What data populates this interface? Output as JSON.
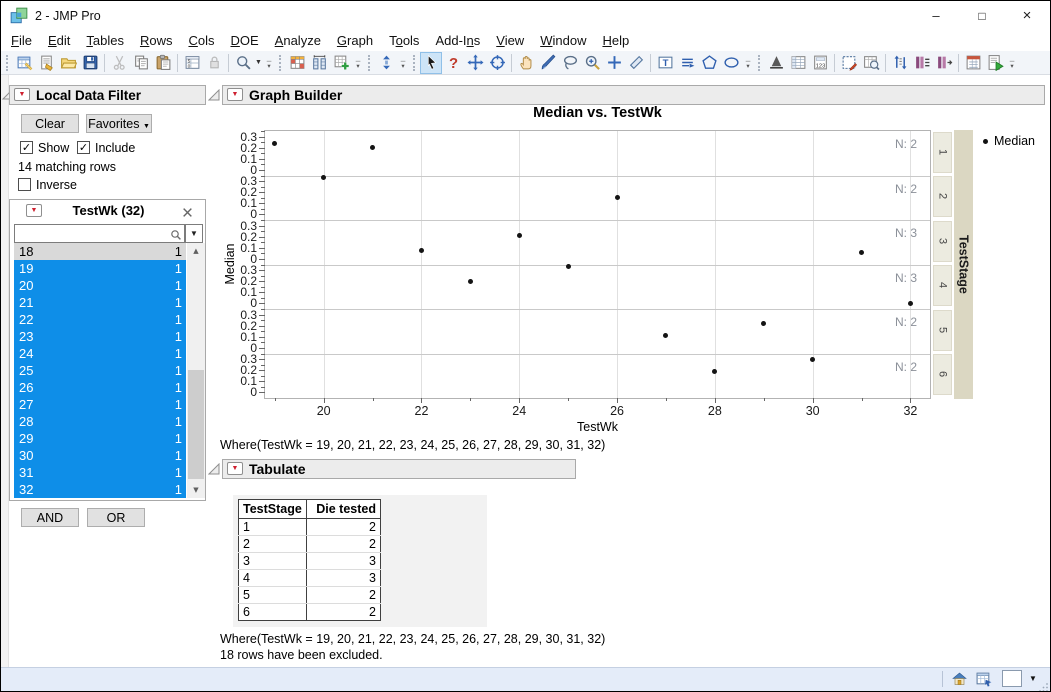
{
  "window": {
    "title": "2 - JMP Pro",
    "controls": {
      "minimize": "–",
      "maximize": "□",
      "close": "×"
    }
  },
  "menu": {
    "items": [
      {
        "label": "File",
        "accel": 0
      },
      {
        "label": "Edit",
        "accel": 0
      },
      {
        "label": "Tables",
        "accel": 0
      },
      {
        "label": "Rows",
        "accel": 0
      },
      {
        "label": "Cols",
        "accel": 0
      },
      {
        "label": "DOE",
        "accel": 0
      },
      {
        "label": "Analyze",
        "accel": 0
      },
      {
        "label": "Graph",
        "accel": 0
      },
      {
        "label": "Tools",
        "accel": 1
      },
      {
        "label": "Add-Ins",
        "accel": 5
      },
      {
        "label": "View",
        "accel": 0
      },
      {
        "label": "Window",
        "accel": 0
      },
      {
        "label": "Help",
        "accel": 0
      }
    ]
  },
  "toolbar": {
    "items": [
      {
        "t": "grip"
      },
      {
        "t": "icon",
        "name": "new-data-table"
      },
      {
        "t": "icon",
        "name": "journal"
      },
      {
        "t": "icon",
        "name": "open"
      },
      {
        "t": "icon",
        "name": "save"
      },
      {
        "t": "sep"
      },
      {
        "t": "icon",
        "name": "cut",
        "disabled": true
      },
      {
        "t": "icon",
        "name": "copy"
      },
      {
        "t": "icon",
        "name": "paste"
      },
      {
        "t": "sep"
      },
      {
        "t": "icon",
        "name": "data-table-window"
      },
      {
        "t": "icon",
        "name": "lock",
        "disabled": true
      },
      {
        "t": "sep"
      },
      {
        "t": "icon",
        "name": "search"
      },
      {
        "t": "dd"
      },
      {
        "t": "ovf"
      },
      {
        "t": "grip"
      },
      {
        "t": "icon",
        "name": "colored-table"
      },
      {
        "t": "icon",
        "name": "compare-columns"
      },
      {
        "t": "icon",
        "name": "add-table"
      },
      {
        "t": "ovf"
      },
      {
        "t": "grip"
      },
      {
        "t": "icon",
        "name": "navigate"
      },
      {
        "t": "ovf"
      },
      {
        "t": "grip"
      },
      {
        "t": "icon",
        "name": "arrow-tool",
        "selected": true
      },
      {
        "t": "icon",
        "name": "help-tool"
      },
      {
        "t": "icon",
        "name": "move-tool"
      },
      {
        "t": "icon",
        "name": "target-tool"
      },
      {
        "t": "sep"
      },
      {
        "t": "icon",
        "name": "hand-tool"
      },
      {
        "t": "icon",
        "name": "brush-tool"
      },
      {
        "t": "icon",
        "name": "lasso-tool"
      },
      {
        "t": "icon",
        "name": "zoom-tool"
      },
      {
        "t": "icon",
        "name": "crosshair-tool"
      },
      {
        "t": "icon",
        "name": "eraser-tool"
      },
      {
        "t": "sep"
      },
      {
        "t": "icon",
        "name": "text-annotate"
      },
      {
        "t": "icon",
        "name": "line-annotate"
      },
      {
        "t": "icon",
        "name": "polygon-annotate"
      },
      {
        "t": "icon",
        "name": "oval-annotate"
      },
      {
        "t": "ovf"
      },
      {
        "t": "grip"
      },
      {
        "t": "icon",
        "name": "distribution"
      },
      {
        "t": "icon",
        "name": "grid-list"
      },
      {
        "t": "icon",
        "name": "calculator"
      },
      {
        "t": "sep"
      },
      {
        "t": "icon",
        "name": "edit-select"
      },
      {
        "t": "icon",
        "name": "table-search"
      },
      {
        "t": "sep"
      },
      {
        "t": "icon",
        "name": "sort-columns"
      },
      {
        "t": "icon",
        "name": "join-columns"
      },
      {
        "t": "icon",
        "name": "split-columns"
      },
      {
        "t": "sep"
      },
      {
        "t": "icon",
        "name": "formula-table"
      },
      {
        "t": "icon",
        "name": "run-script"
      },
      {
        "t": "ovf"
      }
    ]
  },
  "filter_panel": {
    "title": "Local Data Filter",
    "clear_label": "Clear",
    "favorites_label": "Favorites",
    "show_label": "Show",
    "include_label": "Include",
    "matching_text": "14 matching rows",
    "inverse_label": "Inverse",
    "and_label": "AND",
    "or_label": "OR",
    "field": {
      "title": "TestWk (32)",
      "search_value": "",
      "items": [
        {
          "value": "18",
          "count": "1",
          "state": "excluded"
        },
        {
          "value": "19",
          "count": "1",
          "state": "selected"
        },
        {
          "value": "20",
          "count": "1",
          "state": "selected"
        },
        {
          "value": "21",
          "count": "1",
          "state": "selected"
        },
        {
          "value": "22",
          "count": "1",
          "state": "selected"
        },
        {
          "value": "23",
          "count": "1",
          "state": "selected"
        },
        {
          "value": "24",
          "count": "1",
          "state": "selected"
        },
        {
          "value": "25",
          "count": "1",
          "state": "selected"
        },
        {
          "value": "26",
          "count": "1",
          "state": "selected"
        },
        {
          "value": "27",
          "count": "1",
          "state": "selected"
        },
        {
          "value": "28",
          "count": "1",
          "state": "selected"
        },
        {
          "value": "29",
          "count": "1",
          "state": "selected"
        },
        {
          "value": "30",
          "count": "1",
          "state": "selected"
        },
        {
          "value": "31",
          "count": "1",
          "state": "selected"
        },
        {
          "value": "32",
          "count": "1",
          "state": "selected"
        }
      ]
    }
  },
  "graph_builder": {
    "title": "Graph Builder",
    "where_text": "Where(TestWk = 19, 20, 21, 22, 23, 24, 25, 26, 27, 28, 29, 30, 31, 32)"
  },
  "chart_data": {
    "type": "scatter",
    "title": "Median vs. TestWk",
    "xlabel": "TestWk",
    "ylabel": "Median",
    "panel_label": "TestStage",
    "legend": [
      "Median"
    ],
    "legend_position": "right",
    "grid": true,
    "x_ticks": [
      20,
      22,
      24,
      26,
      28,
      30,
      32
    ],
    "x_minor_ticks": [
      19,
      21,
      23,
      25,
      27,
      29,
      31
    ],
    "xlim": [
      18.8,
      32.4
    ],
    "y_ticks": [
      0.3,
      0.2,
      0.1,
      0
    ],
    "y_minor_ticks": [
      0.35,
      0.25,
      0.15,
      0.05
    ],
    "panel_ylim": [
      -0.05,
      0.35
    ],
    "panels": [
      {
        "stage": "1",
        "n_label": "N: 2",
        "points": [
          {
            "x": 19,
            "y": 0.24
          },
          {
            "x": 21,
            "y": 0.2
          }
        ]
      },
      {
        "stage": "2",
        "n_label": "N: 2",
        "points": [
          {
            "x": 20,
            "y": 0.33
          },
          {
            "x": 26,
            "y": 0.15
          }
        ]
      },
      {
        "stage": "3",
        "n_label": "N: 3",
        "points": [
          {
            "x": 22,
            "y": 0.08
          },
          {
            "x": 24,
            "y": 0.21
          },
          {
            "x": 31,
            "y": 0.06
          }
        ]
      },
      {
        "stage": "4",
        "n_label": "N: 3",
        "points": [
          {
            "x": 23,
            "y": 0.2
          },
          {
            "x": 25,
            "y": 0.33
          },
          {
            "x": 32,
            "y": 0.0
          }
        ]
      },
      {
        "stage": "5",
        "n_label": "N: 2",
        "points": [
          {
            "x": 27,
            "y": 0.11
          },
          {
            "x": 29,
            "y": 0.22
          }
        ]
      },
      {
        "stage": "6",
        "n_label": "N: 2",
        "points": [
          {
            "x": 28,
            "y": 0.19
          },
          {
            "x": 30,
            "y": 0.3
          }
        ]
      }
    ]
  },
  "tabulate": {
    "title": "Tabulate",
    "table": {
      "columns": [
        "TestStage",
        "Die tested"
      ],
      "rows": [
        [
          "1",
          "2"
        ],
        [
          "2",
          "2"
        ],
        [
          "3",
          "3"
        ],
        [
          "4",
          "3"
        ],
        [
          "5",
          "2"
        ],
        [
          "6",
          "2"
        ]
      ]
    },
    "where_text": "Where(TestWk = 19, 20, 21, 22, 23, 24, 25, 26, 27, 28, 29, 30, 31, 32)",
    "excluded_text": "18 rows have been excluded."
  },
  "status_bar": {
    "icons": [
      "home",
      "window-list",
      "status-box",
      "dropdown"
    ]
  },
  "colors": {
    "selection_blue": "#0e8ee8",
    "excluded_gray": "#d9d9d9",
    "header_bar": "#ececec",
    "red_triangle": "#cf2030",
    "panel_beige": "#ecebe0",
    "panel_label_beige": "#dbd7c2",
    "n_label_gray": "#8b9099",
    "status_bar_bg": "#e4ecf9",
    "point_black": "#141414"
  }
}
